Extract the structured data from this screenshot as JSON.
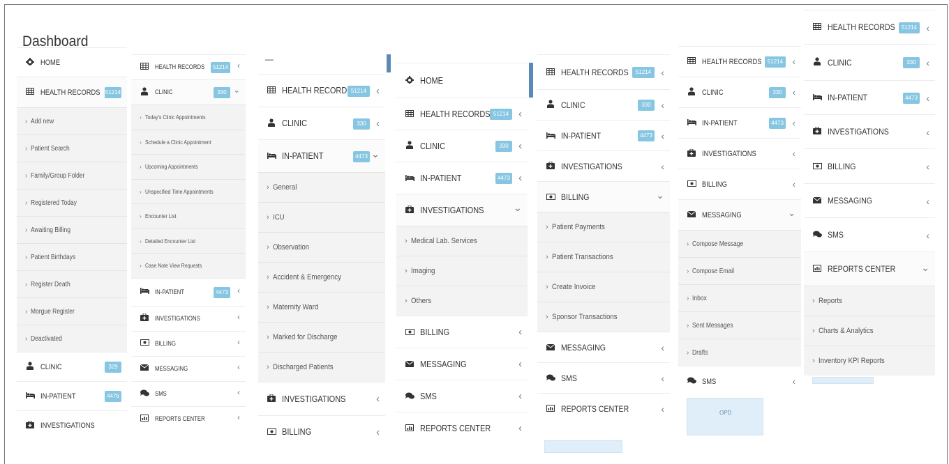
{
  "page": {
    "title": "Dashboard"
  },
  "panel1": {
    "home": "HOME",
    "health_records": "HEALTH RECORDS",
    "health_records_count": "51214",
    "subs": [
      "Add new",
      "Patient Search",
      "Family/Group Folder",
      "Registered Today",
      "Awaiting Billing",
      "Patient Birthdays",
      "Register Death",
      "Morgue Register",
      "Deactivated"
    ],
    "clinic": "CLINIC",
    "clinic_count": "329",
    "inpatient": "IN-PATIENT",
    "inpatient_count": "4476",
    "investigations": "INVESTIGATIONS"
  },
  "panel2": {
    "health_records": "HEALTH RECORDS",
    "health_records_count": "51214",
    "clinic": "CLINIC",
    "clinic_count": "330",
    "subs": [
      "Today's Clinic Appointments",
      "Schedule a Clinic Appointment",
      "Upcoming Appointments",
      "Unspecified Time Appointments",
      "Encounter List",
      "Detailed Encounter List",
      "Case Note View Requests"
    ],
    "inpatient": "IN-PATIENT",
    "inpatient_count": "4473",
    "investigations": "INVESTIGATIONS",
    "billing": "BILLING",
    "messaging": "MESSAGING",
    "sms": "SMS",
    "reports": "REPORTS CENTER"
  },
  "panel3": {
    "top_mark": "—",
    "health_records": "HEALTH RECORDS",
    "health_records_count": "51214",
    "clinic": "CLINIC",
    "clinic_count": "330",
    "inpatient": "IN-PATIENT",
    "inpatient_count": "4473",
    "subs": [
      "General",
      "ICU",
      "Observation",
      "Accident & Emergency",
      "Maternity Ward",
      "Marked for Discharge",
      "Discharged Patients"
    ],
    "investigations": "INVESTIGATIONS",
    "billing": "BILLING"
  },
  "panel4": {
    "home": "HOME",
    "health_records": "HEALTH RECORDS",
    "health_records_count": "51214",
    "clinic": "CLINIC",
    "clinic_count": "330",
    "inpatient": "IN-PATIENT",
    "inpatient_count": "4473",
    "investigations": "INVESTIGATIONS",
    "subs": [
      "Medical Lab. Services",
      "Imaging",
      "Others"
    ],
    "billing": "BILLING",
    "messaging": "MESSAGING",
    "sms": "SMS",
    "reports": "REPORTS CENTER"
  },
  "panel5": {
    "health_records": "HEALTH RECORDS",
    "health_records_count": "51214",
    "clinic": "CLINIC",
    "clinic_count": "330",
    "inpatient": "IN-PATIENT",
    "inpatient_count": "4473",
    "investigations": "INVESTIGATIONS",
    "billing": "BILLING",
    "subs": [
      "Patient Payments",
      "Patient Transactions",
      "Create Invoice",
      "Sponsor Transactions"
    ],
    "messaging": "MESSAGING",
    "sms": "SMS",
    "reports": "REPORTS CENTER"
  },
  "panel6": {
    "health_records": "HEALTH RECORDS",
    "health_records_count": "51214",
    "clinic": "CLINIC",
    "clinic_count": "330",
    "inpatient": "IN-PATIENT",
    "inpatient_count": "4473",
    "investigations": "INVESTIGATIONS",
    "billing": "BILLING",
    "messaging": "MESSAGING",
    "subs": [
      "Compose Message",
      "Compose Email",
      "Inbox",
      "Sent Messages",
      "Drafts"
    ],
    "sms": "SMS",
    "opd": "OPD"
  },
  "panel7": {
    "health_records": "HEALTH RECORDS",
    "health_records_count": "51214",
    "clinic": "CLINIC",
    "clinic_count": "330",
    "inpatient": "IN-PATIENT",
    "inpatient_count": "4473",
    "investigations": "INVESTIGATIONS",
    "billing": "BILLING",
    "messaging": "MESSAGING",
    "sms": "SMS",
    "reports": "REPORTS CENTER",
    "subs": [
      "Reports",
      "Charts & Analytics",
      "Inventory KPI Reports"
    ]
  },
  "icons": {
    "home": "home-icon",
    "health_records": "table-icon",
    "clinic": "user-md-icon",
    "inpatient": "bed-icon",
    "investigations": "medkit-icon",
    "billing": "money-icon",
    "messaging": "envelope-icon",
    "sms": "comments-icon",
    "reports": "chart-icon"
  },
  "colors": {
    "badge": "#86c6e2",
    "accent_bar": "#5b89b6",
    "submenu_bg": "#f3f3f3"
  }
}
